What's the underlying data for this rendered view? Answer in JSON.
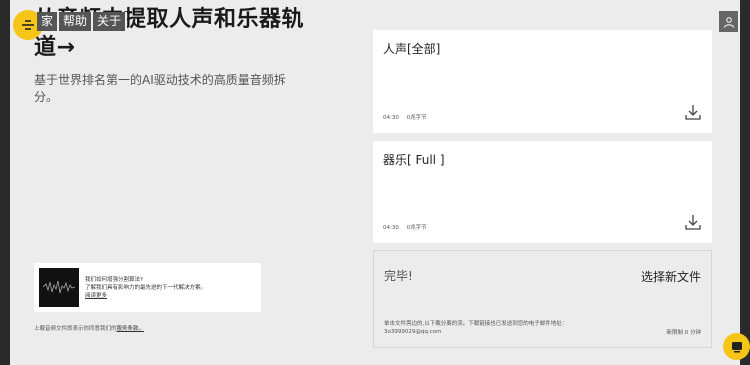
{
  "nav": {
    "home": "家",
    "help": "帮助",
    "about": "关于"
  },
  "hero": {
    "title": "从音频中提取人声和乐器轨道→",
    "subtitle": "基于世界排名第一的AI驱动技术的高质量音频拆分。"
  },
  "promo": {
    "line1": "我们如何增强分割算法?",
    "line2": "了解我们具有影响力的最先进的下一代解决方案。",
    "link": "阅读更多"
  },
  "terms": {
    "text": "上载音频文件即表示你同意我们的",
    "link": "服务条款。"
  },
  "tracks": [
    {
      "title": "人声[全部]",
      "duration": "04:30",
      "size": "0兆字节"
    },
    {
      "title": "器乐[ Full ]",
      "duration": "04:30",
      "size": "0兆字节"
    }
  ],
  "done": {
    "title": "完毕!",
    "new_file": "选择新文件",
    "note": "单击文件旁边的,以下载分离的流。下载链接也已发送到您的电子邮件地址：3o3999029@qq.com",
    "footer_label": "新限制",
    "footer_value": "0 分钟"
  },
  "colors": {
    "accent": "#f5c518",
    "background": "#ececec",
    "card": "#ffffff"
  },
  "icons": {
    "logo": "mixer-icon",
    "account": "user-icon",
    "download": "download-icon",
    "chat": "chat-icon"
  }
}
